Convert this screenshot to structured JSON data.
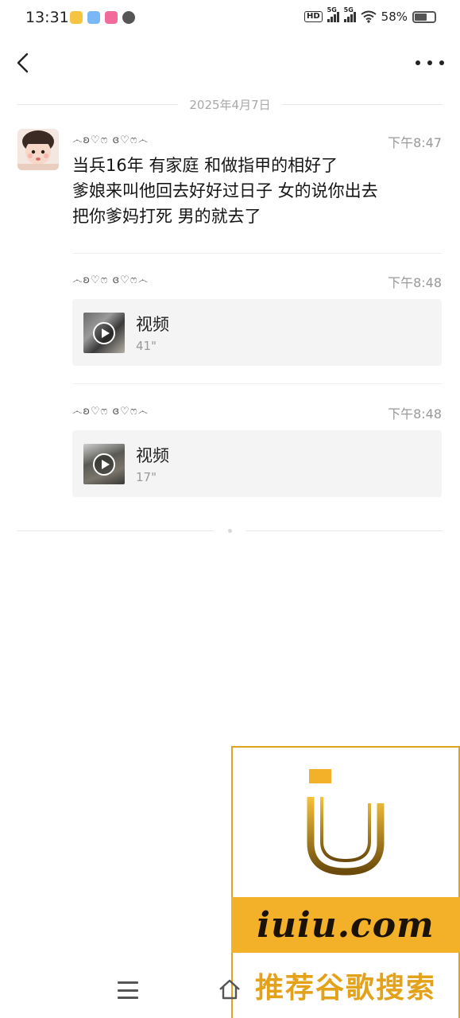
{
  "status_bar": {
    "time": "13:31",
    "network_hd": "HD",
    "network_1": "5G",
    "network_2": "5G",
    "battery_percent": "58%",
    "battery_level": 0.58,
    "app_icons": [
      "weibo-icon",
      "app-icon-2",
      "app-icon-3",
      "app-icon-4"
    ]
  },
  "nav": {
    "back_icon": "chevron-left-icon",
    "more_icon": "more-dots-icon"
  },
  "date_divider": "2025年4月7日",
  "messages": [
    {
      "sender": "෴ʚ♡ෆ ɞ♡ෆ෴",
      "time": "下午8:47",
      "lines": [
        "当兵16年 有家庭 和做指甲的相好了",
        "爹娘来叫他回去好好过日子 女的说你出去",
        "把你爹妈打死  男的就去了"
      ]
    },
    {
      "sender": "෴ʚ♡ෆ ɞ♡ෆ෴",
      "time": "下午8:48",
      "video": {
        "title": "视频",
        "duration": "41\""
      }
    },
    {
      "sender": "෴ʚ♡ෆ ɞ♡ෆ෴",
      "time": "下午8:48",
      "video": {
        "title": "视频",
        "duration": "17\""
      }
    }
  ],
  "watermark": {
    "domain": "iuiu.com",
    "slogan": "推荐谷歌搜索"
  },
  "bottom_nav": {
    "menu_icon": "menu-icon",
    "home_icon": "home-icon"
  }
}
